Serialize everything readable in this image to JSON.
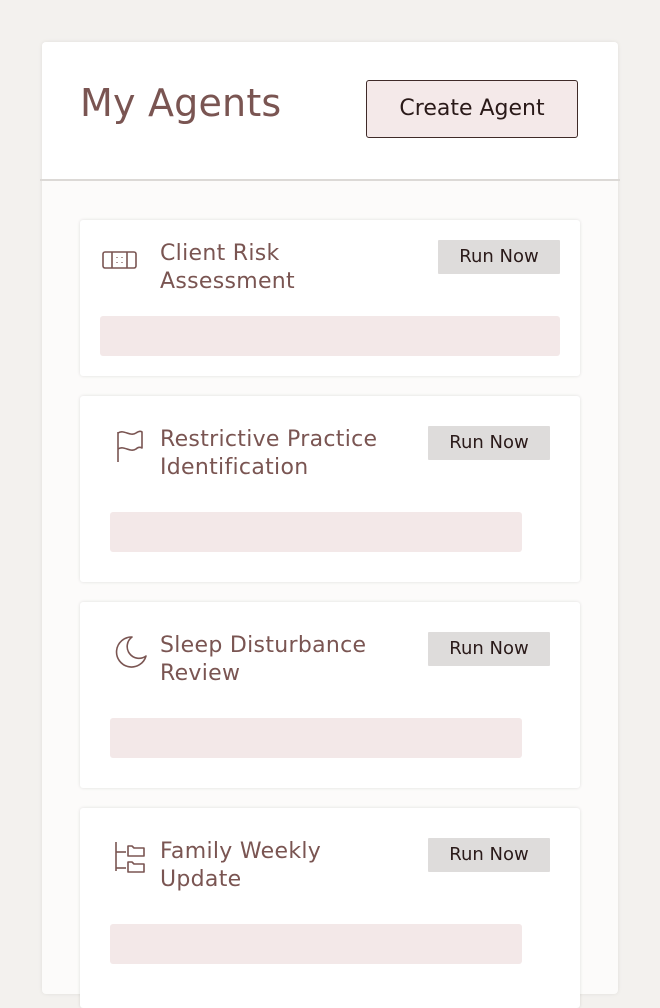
{
  "header": {
    "title": "My Agents",
    "create_button_label": "Create Agent"
  },
  "agents": [
    {
      "title_line1": "Client Risk",
      "title_line2": "Assessment",
      "icon": "ticket-icon",
      "run_label": "Run Now"
    },
    {
      "title_line1": "Restrictive Practice",
      "title_line2": "Identification",
      "icon": "flag-icon",
      "run_label": "Run Now"
    },
    {
      "title_line1": "Sleep Disturbance",
      "title_line2": "Review",
      "icon": "moon-icon",
      "run_label": "Run Now"
    },
    {
      "title_line1": "Family Weekly",
      "title_line2": "Update",
      "icon": "folder-tree-icon",
      "run_label": "Run Now"
    }
  ],
  "colors": {
    "accent_text": "#7a5552",
    "button_bg": "#f4e9e9",
    "run_button_bg": "#dedcdb",
    "placeholder_bg": "#f3e8e8",
    "page_bg": "#f3f1ee"
  }
}
